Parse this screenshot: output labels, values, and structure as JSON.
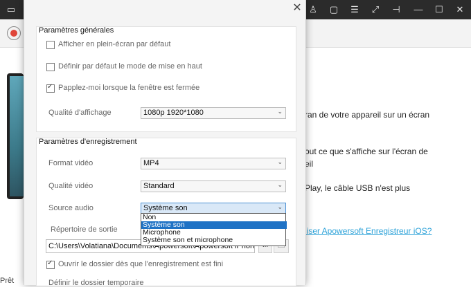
{
  "status_bar": {
    "text": "Prêt"
  },
  "background": {
    "lines": [
      "ran de votre appareil sur un écran",
      "out ce que s'affiche sur l'écran de",
      "eil",
      "Play, le câble USB n'est plus"
    ],
    "link": "liser Apowersoft Enregistreur iOS?"
  },
  "dialog": {
    "general": {
      "title": "Paramètres générales",
      "fullscreen_label": "Afficher en plein-écran par défaut",
      "fullscreen_checked": false,
      "ontop_label": "Définir par défaut le mode de mise en haut",
      "ontop_checked": false,
      "remind_label": "Papplez-moi lorsque la fenêtre est fermée",
      "remind_checked": true,
      "quality_label": "Qualité d'affichage",
      "quality_value": "1080p 1920*1080"
    },
    "recording": {
      "title": "Paramètres d'enregistrement",
      "format_label": "Format vidéo",
      "format_value": "MP4",
      "vquality_label": "Qualité vidéo",
      "vquality_value": "Standard",
      "audio_label": "Source audio",
      "audio_value": "Système son",
      "audio_options": [
        "Non",
        "Système son",
        "Microphone",
        "Système son et microphone"
      ],
      "audio_selected_index": 1,
      "output_label": "Répertoire de sortie",
      "output_path": "C:\\Users\\Volatiana\\Documents\\Apowersoft\\Apowersoft iPhone",
      "browse_label": "...",
      "open_folder_label": "Ouvrir le dossier dès que l'enregistrement est fini",
      "open_folder_checked": true,
      "temp_label": "Définir le dossier temporaire"
    }
  },
  "colors": {
    "titlebar": "#2b2b2b",
    "accent": "#1f72c5",
    "link": "#2aa1d8",
    "record": "#e0463a"
  }
}
